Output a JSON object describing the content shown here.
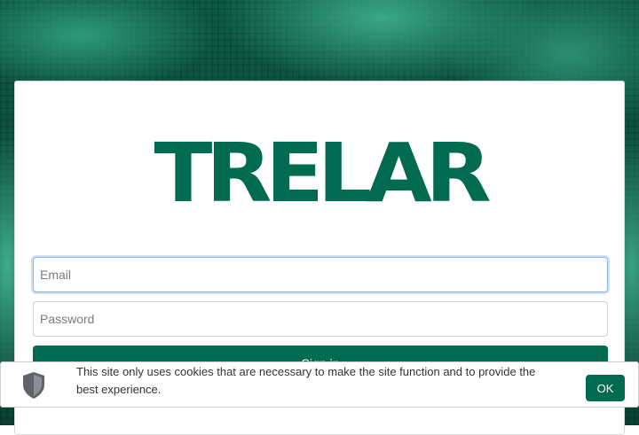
{
  "logo": {
    "text": "TRELAR"
  },
  "login": {
    "email_placeholder": "Email",
    "password_placeholder": "Password",
    "submit_label": "Sign in"
  },
  "cookie_banner": {
    "message": "This site only uses cookies that are necessary to make the site function and to provide the best experience.",
    "ok_label": "OK",
    "icon": "shield-icon"
  },
  "colors": {
    "brand": "#006b50",
    "background": "#0b4a38",
    "focus_ring": "#86b7e9"
  }
}
